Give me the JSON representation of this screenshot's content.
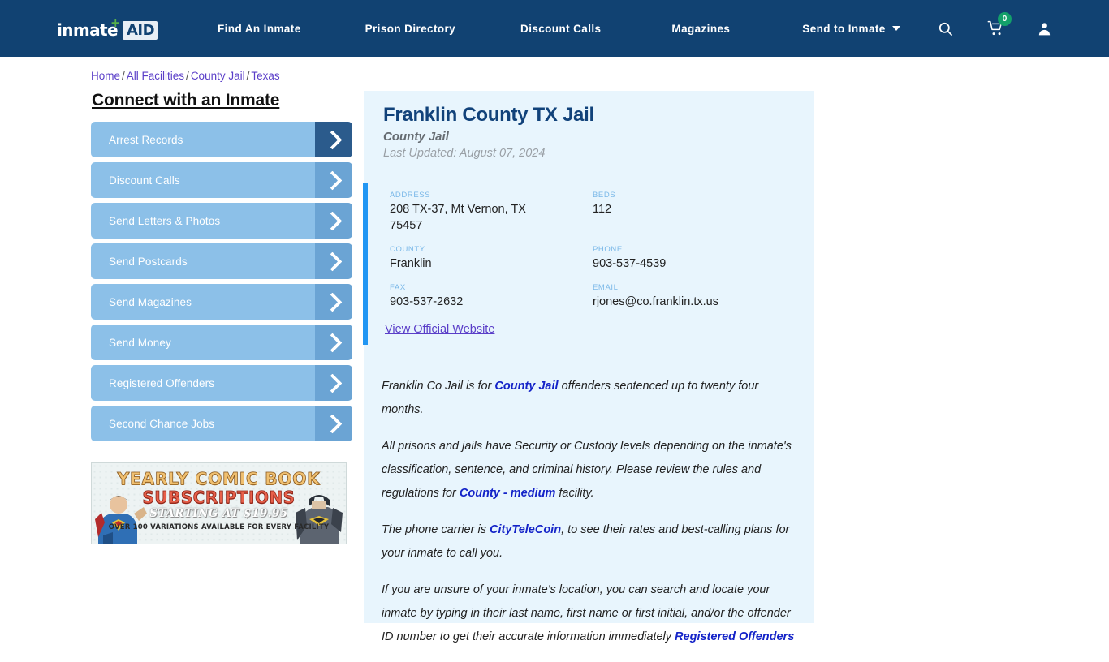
{
  "nav": {
    "logo": {
      "word": "inmate",
      "plus": "+",
      "aid": "AID"
    },
    "links": [
      {
        "label": "Find An Inmate"
      },
      {
        "label": "Prison Directory"
      },
      {
        "label": "Discount Calls"
      },
      {
        "label": "Magazines"
      },
      {
        "label": "Send to Inmate"
      }
    ],
    "icons": {
      "search": "search-icon",
      "cart": "cart-icon",
      "cart_badge": "0",
      "account": "user-icon"
    },
    "colors": {
      "background": "#114272",
      "badge": "#13a06a",
      "logo_plus": "#56b04a"
    }
  },
  "breadcrumb": {
    "items": [
      "Home",
      "All Facilities",
      "County Jail",
      "Texas"
    ],
    "separator": "/"
  },
  "sidebar": {
    "title": "Connect with an Inmate",
    "items": [
      {
        "label": "Arrest Records",
        "active": true
      },
      {
        "label": "Discount Calls",
        "active": false
      },
      {
        "label": "Send Letters & Photos",
        "active": false
      },
      {
        "label": "Send Postcards",
        "active": false
      },
      {
        "label": "Send Magazines",
        "active": false
      },
      {
        "label": "Send Money",
        "active": false
      },
      {
        "label": "Registered Offenders",
        "active": false
      },
      {
        "label": "Second Chance Jobs",
        "active": false
      }
    ]
  },
  "ad": {
    "line1": "YEARLY COMIC BOOK",
    "line2": "SUBSCRIPTIONS",
    "line3": "STARTING AT $19.95",
    "line4": "OVER 100 VARIATIONS AVAILABLE FOR EVERY FACILITY"
  },
  "facility": {
    "title": "Franklin County TX Jail",
    "type": "County Jail",
    "last_updated": "Last Updated: August 07, 2024",
    "fields": {
      "address_label": "ADDRESS",
      "address_value": "208 TX-37, Mt Vernon, TX 75457",
      "beds_label": "BEDS",
      "beds_value": "112",
      "county_label": "COUNTY",
      "county_value": "Franklin",
      "phone_label": "PHONE",
      "phone_value": "903-537-4539",
      "fax_label": "FAX",
      "fax_value": "903-537-2632",
      "email_label": "EMAIL",
      "email_value": "rjones@co.franklin.tx.us"
    },
    "official_website_link": "View Official Website",
    "accent_color": "#2196f3",
    "panel_color": "#e8f5fd"
  },
  "description": {
    "p1_a": "Franklin Co Jail is for ",
    "p1_link": "County Jail",
    "p1_b": " offenders sentenced up to twenty four months.",
    "p2_a": "All prisons and jails have Security or Custody levels depending on the inmate's classification, sentence, and criminal history. Please review the rules and regulations for ",
    "p2_link": "County - medium",
    "p2_b": " facility.",
    "p3_a": "The phone carrier is ",
    "p3_link": "CityTeleCoin",
    "p3_b": ", to see their rates and best-calling plans for your inmate to call you.",
    "p4_a": "If you are unsure of your inmate's location, you can search and locate your inmate by typing in their last name, first name or first initial, and/or the offender ID number to get their accurate information immediately ",
    "p4_link": "Registered Offenders"
  }
}
